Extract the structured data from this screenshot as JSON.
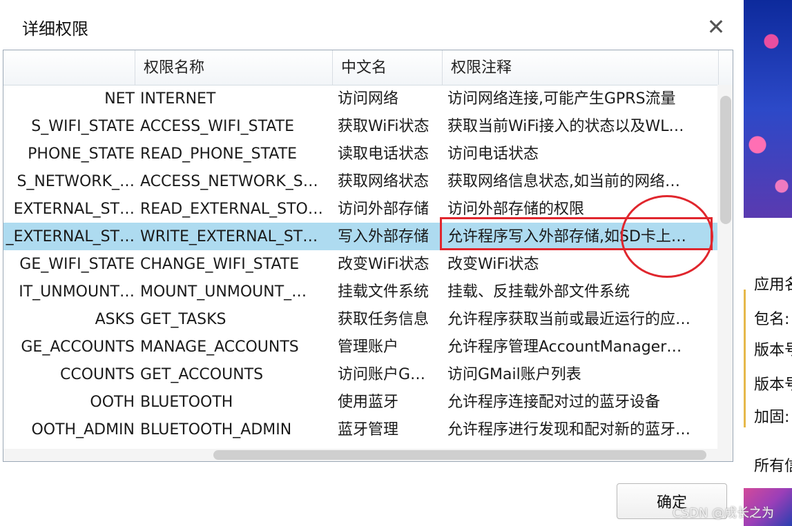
{
  "dialog": {
    "title": "详细权限",
    "ok_label": "确定"
  },
  "table": {
    "headers": [
      "",
      "权限名称",
      "中文名",
      "权限注释"
    ],
    "rows": [
      {
        "c0": "NET",
        "c1": "INTERNET",
        "c2": "访问网络",
        "c3": "访问网络连接,可能产生GPRS流量",
        "selected": false
      },
      {
        "c0": "S_WIFI_STATE",
        "c1": "ACCESS_WIFI_STATE",
        "c2": "获取WiFi状态",
        "c3": "获取当前WiFi接入的状态以及WL…",
        "selected": false
      },
      {
        "c0": "PHONE_STATE",
        "c1": "READ_PHONE_STATE",
        "c2": "读取电话状态",
        "c3": "访问电话状态",
        "selected": false
      },
      {
        "c0": "S_NETWORK_…",
        "c1": "ACCESS_NETWORK_S…",
        "c2": "获取网络状态",
        "c3": "获取网络信息状态,如当前的网络…",
        "selected": false
      },
      {
        "c0": "EXTERNAL_ST…",
        "c1": "READ_EXTERNAL_STO…",
        "c2": "访问外部存储",
        "c3": "访问外部存储的权限",
        "selected": false
      },
      {
        "c0": "_EXTERNAL_ST…",
        "c1": "WRITE_EXTERNAL_ST…",
        "c2": "写入外部存储",
        "c3": "允许程序写入外部存储,如SD卡上…",
        "selected": true
      },
      {
        "c0": "GE_WIFI_STATE",
        "c1": "CHANGE_WIFI_STATE",
        "c2": "改变WiFi状态",
        "c3": "改变WiFi状态",
        "selected": false
      },
      {
        "c0": "IT_UNMOUNT…",
        "c1": "MOUNT_UNMOUNT_…",
        "c2": "挂载文件系统",
        "c3": "挂载、反挂载外部文件系统",
        "selected": false
      },
      {
        "c0": "ASKS",
        "c1": "GET_TASKS",
        "c2": "获取任务信息",
        "c3": "允许程序获取当前或最近运行的应…",
        "selected": false
      },
      {
        "c0": "GE_ACCOUNTS",
        "c1": "MANAGE_ACCOUNTS",
        "c2": "管理账户",
        "c3": "允许程序管理AccountManager…",
        "selected": false
      },
      {
        "c0": "CCOUNTS",
        "c1": "GET_ACCOUNTS",
        "c2": "访问账户G…",
        "c3": "访问GMail账户列表",
        "selected": false
      },
      {
        "c0": "OOTH",
        "c1": "BLUETOOTH",
        "c2": "使用蓝牙",
        "c3": "允许程序连接配对过的蓝牙设备",
        "selected": false
      },
      {
        "c0": "OOTH_ADMIN",
        "c1": "BLUETOOTH_ADMIN",
        "c2": "蓝牙管理",
        "c3": "允许程序进行发现和配对新的蓝牙…",
        "selected": false
      }
    ]
  },
  "background_panel": {
    "labels": [
      "应用名",
      "包名:",
      "版本号",
      "版本号",
      "加固:",
      "所有信"
    ]
  },
  "watermark": "CSDN @成长之为",
  "colors": {
    "selection": "#aedbf0",
    "annotation_red": "#e0262d"
  },
  "icons": {
    "close": "close-icon"
  }
}
